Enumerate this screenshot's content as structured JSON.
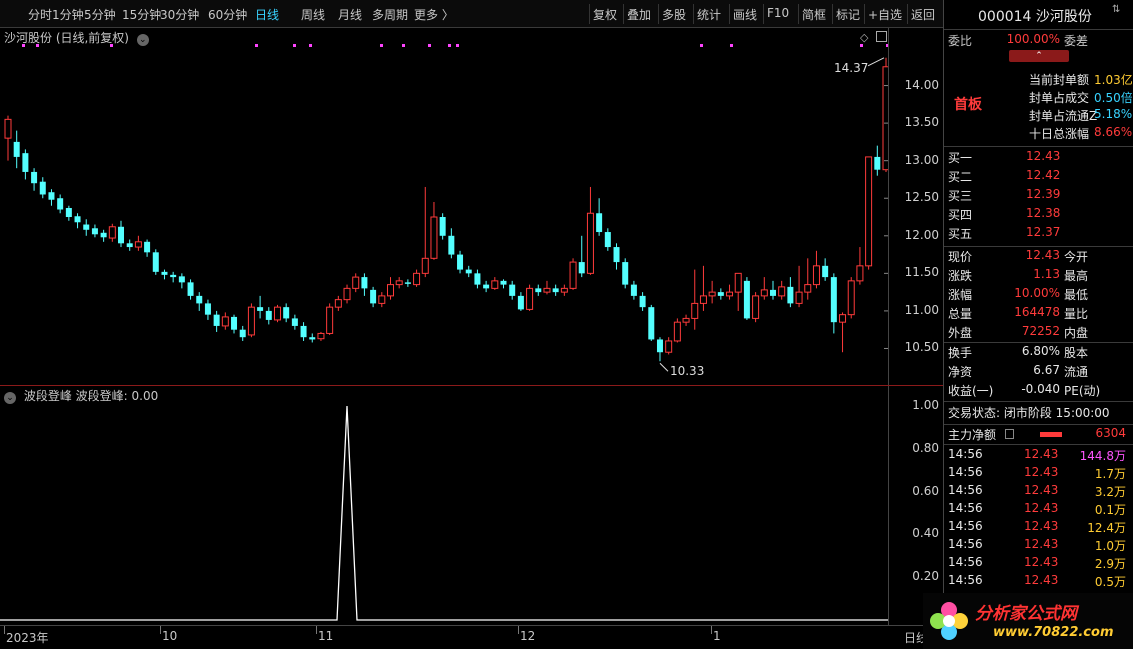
{
  "toolbar": {
    "left": [
      "分时",
      "1分钟",
      "5分钟",
      "15分钟",
      "30分钟",
      "60分钟",
      "日线",
      "周线",
      "月线",
      "多周期",
      "更多 〉"
    ],
    "active_index": 6,
    "right": [
      "复权",
      "叠加",
      "多股",
      "统计",
      "画线",
      "F10",
      "简框",
      "标记",
      "+自选",
      "返回"
    ]
  },
  "main": {
    "title": "沙河股份 (日线,前复权)",
    "price_labels": [
      "14.00",
      "13.50",
      "13.00",
      "12.50",
      "12.00",
      "11.50",
      "11.00",
      "10.50"
    ],
    "high_marker": "14.37",
    "low_marker": "10.33"
  },
  "indicator": {
    "title": "波段登峰  波段登峰: 0.00",
    "labels": [
      "1.00",
      "0.80",
      "0.60",
      "0.40",
      "0.20"
    ]
  },
  "xaxis": {
    "labels": [
      "2023年",
      "10",
      "11",
      "12",
      "1"
    ],
    "right_label": "日线"
  },
  "panel": {
    "stock": "000014 沙河股份",
    "weibi_label": "委比",
    "weibi_value": "100.00%",
    "weicha_label": "委差",
    "board": "首板",
    "seal": [
      {
        "label": "当前封单额",
        "value": "1.03亿"
      },
      {
        "label": "封单占成交",
        "value": "0.50倍"
      },
      {
        "label": "封单占流通Z",
        "value": "5.18%"
      },
      {
        "label": "十日总涨幅",
        "value": "8.66%"
      }
    ],
    "bids": [
      {
        "label": "买一",
        "price": "12.43"
      },
      {
        "label": "买二",
        "price": "12.42"
      },
      {
        "label": "买三",
        "price": "12.39"
      },
      {
        "label": "买四",
        "price": "12.38"
      },
      {
        "label": "买五",
        "price": "12.37"
      }
    ],
    "quote": [
      {
        "l1": "现价",
        "v1": "12.43",
        "l2": "今开"
      },
      {
        "l1": "涨跌",
        "v1": "1.13",
        "l2": "最高"
      },
      {
        "l1": "涨幅",
        "v1": "10.00%",
        "l2": "最低"
      },
      {
        "l1": "总量",
        "v1": "164478",
        "l2": "量比"
      },
      {
        "l1": "外盘",
        "v1": "72252",
        "l2": "内盘"
      }
    ],
    "fund": [
      {
        "l1": "换手",
        "v1": "6.80%",
        "l2": "股本"
      },
      {
        "l1": "净资",
        "v1": "6.67",
        "l2": "流通"
      },
      {
        "l1": "收益(一)",
        "v1": "-0.040",
        "l2": "PE(动)"
      }
    ],
    "trade_status": "交易状态: 闭市阶段 15:00:00",
    "main_net_label": "主力净额",
    "main_net_value": "6304",
    "ticks": [
      {
        "time": "14:56",
        "price": "12.43",
        "vol": "144.8万"
      },
      {
        "time": "14:56",
        "price": "12.43",
        "vol": "1.7万"
      },
      {
        "time": "14:56",
        "price": "12.43",
        "vol": "3.2万"
      },
      {
        "time": "14:56",
        "price": "12.43",
        "vol": "0.1万"
      },
      {
        "time": "14:56",
        "price": "12.43",
        "vol": "12.4万"
      },
      {
        "time": "14:56",
        "price": "12.43",
        "vol": "1.0万"
      },
      {
        "time": "14:56",
        "price": "12.43",
        "vol": "2.9万"
      },
      {
        "time": "14:56",
        "price": "12.43",
        "vol": "0.5万"
      }
    ],
    "logo_text": "分析家公式网",
    "logo_url": "www.70822.com"
  },
  "chart_data": {
    "type": "candlestick",
    "title": "沙河股份 (日线,前复权)",
    "ylim": [
      10.2,
      14.5
    ],
    "candles": [
      [
        13.3,
        13.55,
        13.0,
        13.6
      ],
      [
        13.25,
        13.05,
        12.9,
        13.4
      ],
      [
        13.1,
        12.85,
        12.75,
        13.15
      ],
      [
        12.85,
        12.7,
        12.6,
        12.9
      ],
      [
        12.72,
        12.55,
        12.5,
        12.78
      ],
      [
        12.58,
        12.48,
        12.4,
        12.62
      ],
      [
        12.5,
        12.35,
        12.3,
        12.55
      ],
      [
        12.37,
        12.25,
        12.2,
        12.4
      ],
      [
        12.26,
        12.18,
        12.1,
        12.3
      ],
      [
        12.15,
        12.08,
        12.0,
        12.22
      ],
      [
        12.1,
        12.02,
        11.98,
        12.15
      ],
      [
        12.04,
        11.98,
        11.92,
        12.08
      ],
      [
        11.97,
        12.12,
        11.92,
        12.16
      ],
      [
        12.12,
        11.9,
        11.85,
        12.2
      ],
      [
        11.9,
        11.85,
        11.8,
        11.95
      ],
      [
        11.85,
        11.92,
        11.8,
        12.0
      ],
      [
        11.92,
        11.78,
        11.72,
        11.95
      ],
      [
        11.78,
        11.52,
        11.48,
        11.82
      ],
      [
        11.52,
        11.48,
        11.42,
        11.55
      ],
      [
        11.48,
        11.45,
        11.38,
        11.52
      ],
      [
        11.46,
        11.38,
        11.3,
        11.5
      ],
      [
        11.38,
        11.2,
        11.15,
        11.42
      ],
      [
        11.2,
        11.1,
        11.0,
        11.25
      ],
      [
        11.1,
        10.95,
        10.88,
        11.15
      ],
      [
        10.95,
        10.8,
        10.72,
        11.0
      ],
      [
        10.8,
        10.92,
        10.75,
        10.98
      ],
      [
        10.92,
        10.75,
        10.7,
        10.95
      ],
      [
        10.75,
        10.65,
        10.6,
        10.8
      ],
      [
        10.68,
        11.05,
        10.65,
        11.1
      ],
      [
        11.05,
        11.0,
        10.9,
        11.2
      ],
      [
        11.0,
        10.88,
        10.82,
        11.05
      ],
      [
        10.88,
        11.05,
        10.85,
        11.08
      ],
      [
        11.05,
        10.9,
        10.85,
        11.1
      ],
      [
        10.9,
        10.8,
        10.75,
        10.95
      ],
      [
        10.8,
        10.65,
        10.6,
        10.85
      ],
      [
        10.65,
        10.62,
        10.58,
        10.7
      ],
      [
        10.63,
        10.7,
        10.6,
        10.72
      ],
      [
        10.7,
        11.05,
        10.68,
        11.1
      ],
      [
        11.05,
        11.15,
        11.0,
        11.2
      ],
      [
        11.15,
        11.3,
        11.1,
        11.35
      ],
      [
        11.3,
        11.45,
        11.25,
        11.5
      ],
      [
        11.45,
        11.3,
        11.2,
        11.5
      ],
      [
        11.28,
        11.1,
        11.05,
        11.32
      ],
      [
        11.1,
        11.2,
        11.05,
        11.25
      ],
      [
        11.2,
        11.35,
        11.15,
        11.45
      ],
      [
        11.35,
        11.4,
        11.3,
        11.45
      ],
      [
        11.38,
        11.36,
        11.32,
        11.42
      ],
      [
        11.35,
        11.5,
        11.32,
        11.55
      ],
      [
        11.5,
        11.7,
        11.45,
        12.65
      ],
      [
        11.7,
        12.25,
        11.68,
        12.45
      ],
      [
        12.25,
        12.0,
        11.95,
        12.3
      ],
      [
        12.0,
        11.75,
        11.7,
        12.1
      ],
      [
        11.75,
        11.55,
        11.5,
        11.8
      ],
      [
        11.55,
        11.5,
        11.45,
        11.6
      ],
      [
        11.5,
        11.35,
        11.3,
        11.55
      ],
      [
        11.35,
        11.3,
        11.25,
        11.4
      ],
      [
        11.3,
        11.4,
        11.28,
        11.45
      ],
      [
        11.4,
        11.35,
        11.3,
        11.42
      ],
      [
        11.35,
        11.2,
        11.15,
        11.4
      ],
      [
        11.2,
        11.02,
        11.0,
        11.25
      ],
      [
        11.02,
        11.3,
        11.0,
        11.35
      ],
      [
        11.3,
        11.25,
        11.2,
        11.35
      ],
      [
        11.25,
        11.3,
        11.22,
        11.4
      ],
      [
        11.3,
        11.25,
        11.2,
        11.35
      ],
      [
        11.25,
        11.3,
        11.2,
        11.35
      ],
      [
        11.3,
        11.65,
        11.28,
        11.7
      ],
      [
        11.65,
        11.5,
        11.45,
        12.0
      ],
      [
        11.5,
        12.3,
        11.48,
        12.65
      ],
      [
        12.3,
        12.05,
        12.0,
        12.5
      ],
      [
        12.05,
        11.85,
        11.8,
        12.1
      ],
      [
        11.85,
        11.65,
        11.55,
        11.9
      ],
      [
        11.65,
        11.35,
        11.3,
        11.7
      ],
      [
        11.35,
        11.2,
        11.15,
        11.4
      ],
      [
        11.2,
        11.05,
        11.0,
        11.25
      ],
      [
        11.05,
        10.62,
        10.6,
        11.08
      ],
      [
        10.62,
        10.45,
        10.33,
        10.65
      ],
      [
        10.45,
        10.6,
        10.42,
        10.65
      ],
      [
        10.6,
        10.85,
        10.58,
        10.9
      ],
      [
        10.85,
        10.9,
        10.8,
        10.95
      ],
      [
        10.9,
        11.1,
        10.75,
        11.55
      ],
      [
        11.1,
        11.2,
        11.0,
        11.6
      ],
      [
        11.2,
        11.25,
        11.1,
        11.4
      ],
      [
        11.25,
        11.2,
        11.15,
        11.3
      ],
      [
        11.2,
        11.25,
        11.15,
        11.35
      ],
      [
        11.25,
        11.5,
        11.0,
        11.5
      ],
      [
        11.4,
        10.9,
        10.88,
        11.45
      ],
      [
        10.9,
        11.2,
        10.85,
        11.25
      ],
      [
        11.2,
        11.28,
        11.15,
        11.45
      ],
      [
        11.28,
        11.2,
        11.15,
        11.4
      ],
      [
        11.2,
        11.32,
        11.15,
        11.4
      ],
      [
        11.32,
        11.1,
        11.05,
        11.45
      ],
      [
        11.1,
        11.25,
        11.05,
        11.6
      ],
      [
        11.25,
        11.35,
        11.15,
        11.7
      ],
      [
        11.35,
        11.6,
        11.3,
        11.8
      ],
      [
        11.6,
        11.45,
        11.4,
        11.7
      ],
      [
        11.45,
        10.85,
        10.7,
        11.5
      ],
      [
        10.85,
        10.95,
        10.45,
        10.98
      ],
      [
        10.95,
        11.4,
        10.9,
        11.45
      ],
      [
        11.4,
        11.6,
        11.35,
        11.85
      ],
      [
        11.6,
        13.05,
        11.55,
        13.05
      ],
      [
        13.05,
        12.88,
        12.8,
        13.2
      ],
      [
        12.88,
        14.25,
        12.85,
        14.37
      ]
    ]
  }
}
